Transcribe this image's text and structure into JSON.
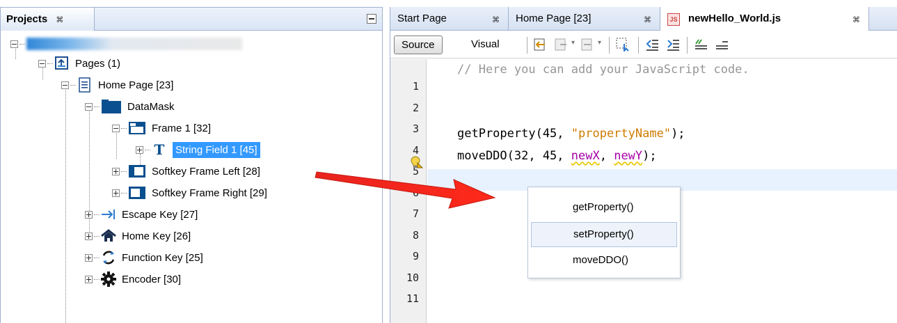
{
  "projects": {
    "title": "Projects",
    "close_glyph": "⌘",
    "root_label": "",
    "nodes": [
      {
        "label": "Pages (1)",
        "icon": "pages-icon"
      },
      {
        "label": "Home Page [23]",
        "icon": "page-icon"
      },
      {
        "label": "DataMask",
        "icon": "folder-icon"
      },
      {
        "label": "Frame 1 [32]",
        "icon": "frame-icon"
      },
      {
        "label": "String Field 1 [45]",
        "icon": "text-field-icon"
      },
      {
        "label": "Softkey Frame Left [28]",
        "icon": "softkey-left-icon"
      },
      {
        "label": "Softkey Frame Right [29]",
        "icon": "softkey-right-icon"
      },
      {
        "label": "Escape Key [27]",
        "icon": "escape-arrow-icon"
      },
      {
        "label": "Home Key [26]",
        "icon": "home-icon"
      },
      {
        "label": "Function Key [25]",
        "icon": "refresh-icon"
      },
      {
        "label": "Encoder [30]",
        "icon": "gear-icon"
      }
    ]
  },
  "editor": {
    "tabs": [
      {
        "label": "Start Page"
      },
      {
        "label": "Home Page [23]"
      },
      {
        "label": "newHello_World.js"
      }
    ],
    "tab_close_glyph": "⌘",
    "toolbar": {
      "source_label": "Source",
      "visual_label": "Visual"
    },
    "line_numbers": [
      "1",
      "2",
      "3",
      "4",
      "5",
      "6",
      "7",
      "8",
      "9",
      "10",
      "11"
    ],
    "code": {
      "line1": "// Here you can add your JavaScript code.",
      "line3_fn": "getProperty(45, ",
      "line3_str": "\"propertyName\"",
      "line3_end": ");",
      "line4_fn": "moveDDO(32, 45, ",
      "line4_x": "newX",
      "line4_sep": ", ",
      "line4_y": "newY",
      "line4_end": ");"
    },
    "completion": [
      "getProperty()",
      "setProperty()",
      "moveDDO()"
    ]
  },
  "colors": {
    "selection": "#3399ff",
    "arrow": "#e8231f",
    "string": "#ce7b00",
    "identifier": "#a600a6"
  }
}
